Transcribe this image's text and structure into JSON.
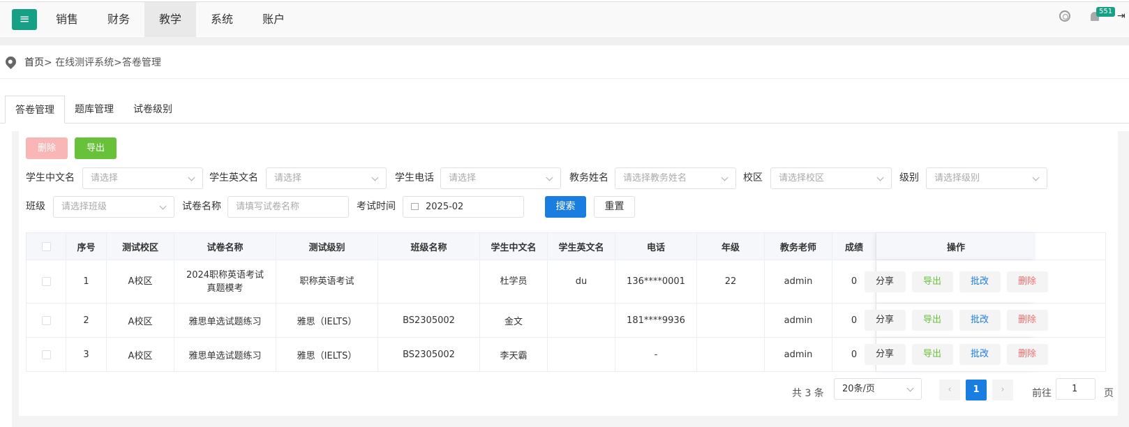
{
  "nav": {
    "items": [
      "销售",
      "财务",
      "教学",
      "系统",
      "账户"
    ],
    "active_index": 2,
    "notification_count": "551",
    "icons": [
      "menu-icon",
      "globe-icon",
      "bell-icon",
      "logout-icon"
    ],
    "accent_color": "#16a085"
  },
  "breadcrumb": {
    "home": "首页",
    "rest": "> 在线测评系统>答卷管理"
  },
  "tabs": [
    "答卷管理",
    "题库管理",
    "试卷级别"
  ],
  "toolbar": {
    "delete_label": "删除",
    "export_label": "导出"
  },
  "filters": {
    "cn_name": {
      "label": "学生中文名",
      "placeholder": "请选择"
    },
    "en_name": {
      "label": "学生英文名",
      "placeholder": "请选择"
    },
    "phone": {
      "label": "学生电话",
      "placeholder": "请选择"
    },
    "staff": {
      "label": "教务姓名",
      "placeholder": "请选择教务姓名"
    },
    "campus": {
      "label": "校区",
      "placeholder": "请选择校区"
    },
    "level": {
      "label": "级别",
      "placeholder": "请选择级别"
    },
    "class": {
      "label": "班级",
      "placeholder": "请选择班级"
    },
    "paper": {
      "label": "试卷名称",
      "placeholder": "请填写试卷名称"
    },
    "date": {
      "label": "考试时间",
      "value": "2025-02"
    },
    "search_label": "搜索",
    "reset_label": "重置"
  },
  "table": {
    "headers": [
      "序号",
      "测试校区",
      "试卷名称",
      "测试级别",
      "班级名称",
      "学生中文名",
      "学生英文名",
      "电话",
      "年级",
      "教务老师",
      "成绩",
      "操作"
    ],
    "rows": [
      {
        "no": "1",
        "campus": "A校区",
        "paper": "2024职称英语考试真题模考",
        "level": "职称英语考试",
        "class": "",
        "cn": "杜学员",
        "en": "du",
        "phone": "136****0001",
        "grade": "22",
        "staff": "admin",
        "score": "0"
      },
      {
        "no": "2",
        "campus": "A校区",
        "paper": "雅思单选试题练习",
        "level": "雅思（IELTS）",
        "class": "BS2305002",
        "cn": "金文",
        "en": "",
        "phone": "181****9936",
        "grade": "",
        "staff": "admin",
        "score": "0"
      },
      {
        "no": "3",
        "campus": "A校区",
        "paper": "雅思单选试题练习",
        "level": "雅思（IELTS）",
        "class": "BS2305002",
        "cn": "李天霸",
        "en": "",
        "phone": "-",
        "grade": "",
        "staff": "admin",
        "score": "0"
      }
    ],
    "actions": {
      "share": "分享",
      "export": "导出",
      "grade": "批改",
      "delete": "删除"
    }
  },
  "pagination": {
    "total": "共 3 条",
    "page_size": "20条/页",
    "current": "1",
    "goto_label": "前往",
    "goto_value": "1",
    "page_suffix": "页"
  }
}
